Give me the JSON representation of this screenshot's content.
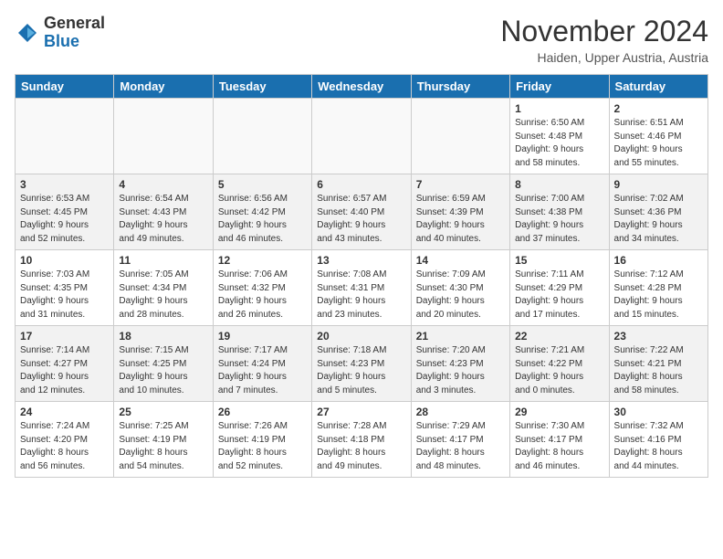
{
  "logo": {
    "general": "General",
    "blue": "Blue"
  },
  "header": {
    "month": "November 2024",
    "location": "Haiden, Upper Austria, Austria"
  },
  "weekdays": [
    "Sunday",
    "Monday",
    "Tuesday",
    "Wednesday",
    "Thursday",
    "Friday",
    "Saturday"
  ],
  "weeks": [
    [
      {
        "day": "",
        "info": ""
      },
      {
        "day": "",
        "info": ""
      },
      {
        "day": "",
        "info": ""
      },
      {
        "day": "",
        "info": ""
      },
      {
        "day": "",
        "info": ""
      },
      {
        "day": "1",
        "info": "Sunrise: 6:50 AM\nSunset: 4:48 PM\nDaylight: 9 hours\nand 58 minutes."
      },
      {
        "day": "2",
        "info": "Sunrise: 6:51 AM\nSunset: 4:46 PM\nDaylight: 9 hours\nand 55 minutes."
      }
    ],
    [
      {
        "day": "3",
        "info": "Sunrise: 6:53 AM\nSunset: 4:45 PM\nDaylight: 9 hours\nand 52 minutes."
      },
      {
        "day": "4",
        "info": "Sunrise: 6:54 AM\nSunset: 4:43 PM\nDaylight: 9 hours\nand 49 minutes."
      },
      {
        "day": "5",
        "info": "Sunrise: 6:56 AM\nSunset: 4:42 PM\nDaylight: 9 hours\nand 46 minutes."
      },
      {
        "day": "6",
        "info": "Sunrise: 6:57 AM\nSunset: 4:40 PM\nDaylight: 9 hours\nand 43 minutes."
      },
      {
        "day": "7",
        "info": "Sunrise: 6:59 AM\nSunset: 4:39 PM\nDaylight: 9 hours\nand 40 minutes."
      },
      {
        "day": "8",
        "info": "Sunrise: 7:00 AM\nSunset: 4:38 PM\nDaylight: 9 hours\nand 37 minutes."
      },
      {
        "day": "9",
        "info": "Sunrise: 7:02 AM\nSunset: 4:36 PM\nDaylight: 9 hours\nand 34 minutes."
      }
    ],
    [
      {
        "day": "10",
        "info": "Sunrise: 7:03 AM\nSunset: 4:35 PM\nDaylight: 9 hours\nand 31 minutes."
      },
      {
        "day": "11",
        "info": "Sunrise: 7:05 AM\nSunset: 4:34 PM\nDaylight: 9 hours\nand 28 minutes."
      },
      {
        "day": "12",
        "info": "Sunrise: 7:06 AM\nSunset: 4:32 PM\nDaylight: 9 hours\nand 26 minutes."
      },
      {
        "day": "13",
        "info": "Sunrise: 7:08 AM\nSunset: 4:31 PM\nDaylight: 9 hours\nand 23 minutes."
      },
      {
        "day": "14",
        "info": "Sunrise: 7:09 AM\nSunset: 4:30 PM\nDaylight: 9 hours\nand 20 minutes."
      },
      {
        "day": "15",
        "info": "Sunrise: 7:11 AM\nSunset: 4:29 PM\nDaylight: 9 hours\nand 17 minutes."
      },
      {
        "day": "16",
        "info": "Sunrise: 7:12 AM\nSunset: 4:28 PM\nDaylight: 9 hours\nand 15 minutes."
      }
    ],
    [
      {
        "day": "17",
        "info": "Sunrise: 7:14 AM\nSunset: 4:27 PM\nDaylight: 9 hours\nand 12 minutes."
      },
      {
        "day": "18",
        "info": "Sunrise: 7:15 AM\nSunset: 4:25 PM\nDaylight: 9 hours\nand 10 minutes."
      },
      {
        "day": "19",
        "info": "Sunrise: 7:17 AM\nSunset: 4:24 PM\nDaylight: 9 hours\nand 7 minutes."
      },
      {
        "day": "20",
        "info": "Sunrise: 7:18 AM\nSunset: 4:23 PM\nDaylight: 9 hours\nand 5 minutes."
      },
      {
        "day": "21",
        "info": "Sunrise: 7:20 AM\nSunset: 4:23 PM\nDaylight: 9 hours\nand 3 minutes."
      },
      {
        "day": "22",
        "info": "Sunrise: 7:21 AM\nSunset: 4:22 PM\nDaylight: 9 hours\nand 0 minutes."
      },
      {
        "day": "23",
        "info": "Sunrise: 7:22 AM\nSunset: 4:21 PM\nDaylight: 8 hours\nand 58 minutes."
      }
    ],
    [
      {
        "day": "24",
        "info": "Sunrise: 7:24 AM\nSunset: 4:20 PM\nDaylight: 8 hours\nand 56 minutes."
      },
      {
        "day": "25",
        "info": "Sunrise: 7:25 AM\nSunset: 4:19 PM\nDaylight: 8 hours\nand 54 minutes."
      },
      {
        "day": "26",
        "info": "Sunrise: 7:26 AM\nSunset: 4:19 PM\nDaylight: 8 hours\nand 52 minutes."
      },
      {
        "day": "27",
        "info": "Sunrise: 7:28 AM\nSunset: 4:18 PM\nDaylight: 8 hours\nand 49 minutes."
      },
      {
        "day": "28",
        "info": "Sunrise: 7:29 AM\nSunset: 4:17 PM\nDaylight: 8 hours\nand 48 minutes."
      },
      {
        "day": "29",
        "info": "Sunrise: 7:30 AM\nSunset: 4:17 PM\nDaylight: 8 hours\nand 46 minutes."
      },
      {
        "day": "30",
        "info": "Sunrise: 7:32 AM\nSunset: 4:16 PM\nDaylight: 8 hours\nand 44 minutes."
      }
    ]
  ]
}
